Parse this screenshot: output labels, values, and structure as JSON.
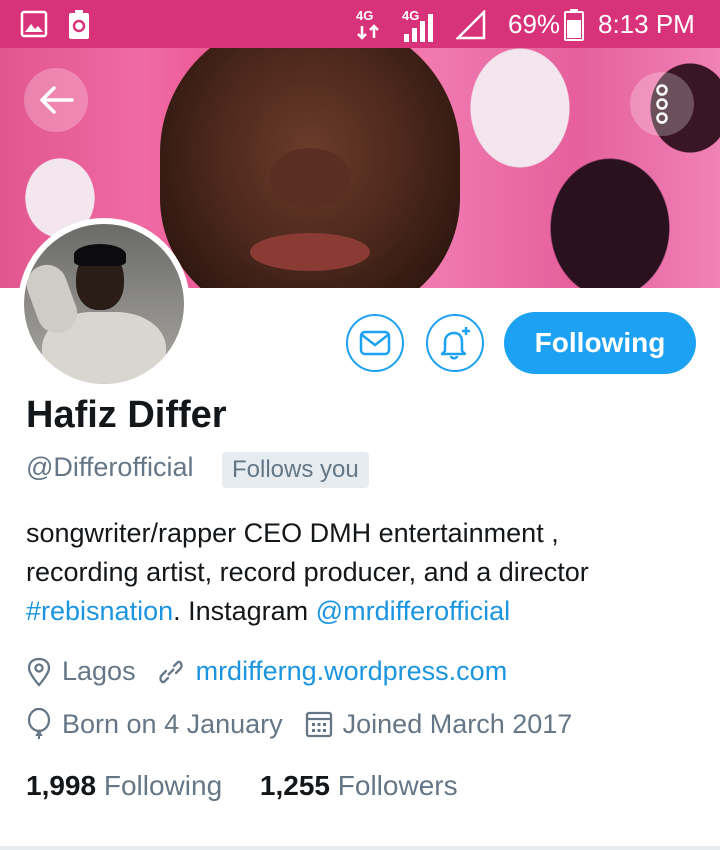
{
  "status_bar": {
    "network_1": "4G",
    "network_2": "4G",
    "battery": "69%",
    "time": "8:13 PM"
  },
  "header": {
    "back_icon": "arrow-left-icon",
    "more_icon": "vertical-dots-icon"
  },
  "profile": {
    "name": "Hafiz Differ",
    "handle": "@Differofficial",
    "follows_you": "Follows you",
    "following_button": "Following",
    "bio": {
      "line1": "songwriter/rapper CEO DMH entertainment ,",
      "line2": "recording artist, record producer, and a director",
      "hashtag": "#rebisnation",
      "middle": ". Instagram ",
      "mention": "@mrdifferofficial"
    },
    "location": "Lagos",
    "website": "mrdifferng.wordpress.com",
    "birthday": "Born on 4 January",
    "joined": "Joined March 2017",
    "following_count": "1,998",
    "following_label": "Following",
    "followers_count": "1,255",
    "followers_label": "Followers"
  },
  "colors": {
    "accent": "#1da1f2",
    "link": "#1b95e0",
    "status_bar": "#d8337a",
    "muted": "#657786"
  }
}
